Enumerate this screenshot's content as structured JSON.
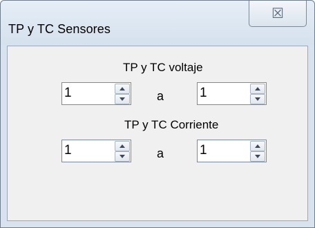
{
  "window": {
    "title": "TP y TC Sensores",
    "close_glyph": "☒"
  },
  "voltage": {
    "label": "TP y TC voltaje",
    "from_value": "1",
    "separator": "a",
    "to_value": "1"
  },
  "current": {
    "label": "TP y TC Corriente",
    "from_value": "1",
    "separator": "a",
    "to_value": "1"
  },
  "icons": {
    "close": "close-icon",
    "spin_up": "spin-up-icon",
    "spin_down": "spin-down-icon"
  }
}
